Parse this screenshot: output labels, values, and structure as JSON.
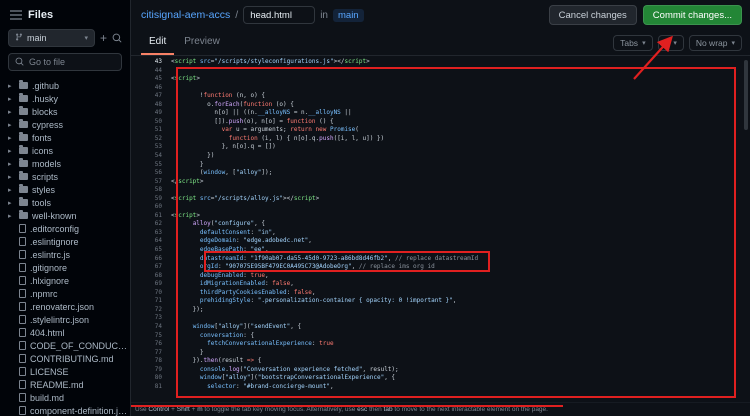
{
  "header": {
    "repo": "citisignal-aem-accs",
    "separator": "/",
    "filename_input": "head.html",
    "in_label": "in",
    "branch": "main",
    "cancel_button": "Cancel changes",
    "commit_button": "Commit changes..."
  },
  "sidebar": {
    "title": "Files",
    "branch": "main",
    "goto_placeholder": "Go to file",
    "folders": [
      ".github",
      ".husky",
      "blocks",
      "cypress",
      "fonts",
      "icons",
      "models",
      "scripts",
      "styles",
      "tools",
      "well-known"
    ],
    "files": [
      ".editorconfig",
      ".eslintignore",
      ".eslintrc.js",
      ".gitignore",
      ".hlxignore",
      ".npmrc",
      ".renovaterc.json",
      ".stylelintrc.json",
      "404.html",
      "CODE_OF_CONDUCT.md",
      "CONTRIBUTING.md",
      "LICENSE",
      "README.md",
      "build.md",
      "component-definition.json"
    ]
  },
  "tabs": {
    "edit": "Edit",
    "preview": "Preview"
  },
  "editor_controls": {
    "indent_mode": "Tabs",
    "indent_size": "4",
    "wrap": "No wrap"
  },
  "colors": {
    "commit_green": "#238636",
    "tab_accent": "#f78166",
    "link_blue": "#58a6ff",
    "annotation_red": "#e02020"
  },
  "status_bar": {
    "segments": [
      {
        "t": "Use "
      },
      {
        "t": "Control",
        "kbd": true
      },
      {
        "t": " + "
      },
      {
        "t": "Shift",
        "kbd": true
      },
      {
        "t": " + "
      },
      {
        "t": "m",
        "kbd": true
      },
      {
        "t": " to toggle the tab key moving focus. Alternatively, use "
      },
      {
        "t": "esc",
        "kbd": true
      },
      {
        "t": " then "
      },
      {
        "t": "tab",
        "kbd": true
      },
      {
        "t": " to move to the next interactable element on the page."
      }
    ]
  },
  "code": {
    "lines": [
      {
        "n": 43,
        "active": true,
        "segs": [
          [
            "p",
            "<"
          ],
          [
            "t",
            "script"
          ],
          [
            "a",
            " src"
          ],
          [
            "p",
            "="
          ],
          [
            "s",
            "\"/scripts/styleconfigurations.js\""
          ],
          [
            "p",
            "></"
          ],
          [
            "t",
            "script"
          ],
          [
            "p",
            ">"
          ]
        ]
      },
      {
        "n": 44,
        "segs": []
      },
      {
        "n": 45,
        "segs": [
          [
            "p",
            "<"
          ],
          [
            "t",
            "script"
          ],
          [
            "p",
            ">"
          ]
        ]
      },
      {
        "n": 46,
        "segs": []
      },
      {
        "n": 47,
        "segs": [
          [
            "p",
            "        !"
          ],
          [
            "k",
            "function"
          ],
          [
            "p",
            " (n, o) {"
          ]
        ]
      },
      {
        "n": 48,
        "segs": [
          [
            "p",
            "          o."
          ],
          [
            "f",
            "forEach"
          ],
          [
            "p",
            "("
          ],
          [
            "k",
            "function"
          ],
          [
            "p",
            " (o) {"
          ]
        ]
      },
      {
        "n": 49,
        "segs": [
          [
            "p",
            "            n[o] || ((n."
          ],
          [
            "b",
            "__alloyNS"
          ],
          [
            "p",
            " = n."
          ],
          [
            "b",
            "__alloyNS"
          ],
          [
            "p",
            " ||"
          ]
        ]
      },
      {
        "n": 50,
        "segs": [
          [
            "p",
            "            [])."
          ],
          [
            "f",
            "push"
          ],
          [
            "p",
            "(o), n[o] = "
          ],
          [
            "k",
            "function"
          ],
          [
            "p",
            " () {"
          ]
        ]
      },
      {
        "n": 51,
        "segs": [
          [
            "p",
            "              "
          ],
          [
            "k",
            "var"
          ],
          [
            "p",
            " u = arguments; "
          ],
          [
            "k",
            "return"
          ],
          [
            "p",
            " "
          ],
          [
            "k",
            "new"
          ],
          [
            "p",
            " "
          ],
          [
            "b",
            "Promise"
          ],
          [
            "p",
            "("
          ]
        ]
      },
      {
        "n": 52,
        "segs": [
          [
            "p",
            "                "
          ],
          [
            "k",
            "function"
          ],
          [
            "p",
            " (i, l) { n[o].q."
          ],
          [
            "f",
            "push"
          ],
          [
            "p",
            "([i, l, u]) })"
          ]
        ]
      },
      {
        "n": 53,
        "segs": [
          [
            "p",
            "              }, n[o].q = [])"
          ]
        ]
      },
      {
        "n": 54,
        "segs": [
          [
            "p",
            "          })"
          ]
        ]
      },
      {
        "n": 55,
        "segs": [
          [
            "p",
            "        }"
          ]
        ]
      },
      {
        "n": 56,
        "segs": [
          [
            "p",
            "        ("
          ],
          [
            "b",
            "window"
          ],
          [
            "p",
            ", ["
          ],
          [
            "s",
            "\"alloy\""
          ],
          [
            "p",
            "]);"
          ]
        ]
      },
      {
        "n": 57,
        "segs": [
          [
            "p",
            "</"
          ],
          [
            "t",
            "script"
          ],
          [
            "p",
            ">"
          ]
        ]
      },
      {
        "n": 58,
        "segs": []
      },
      {
        "n": 59,
        "segs": [
          [
            "p",
            "<"
          ],
          [
            "t",
            "script"
          ],
          [
            "a",
            " src"
          ],
          [
            "p",
            "="
          ],
          [
            "s",
            "\"/scripts/alloy.js\""
          ],
          [
            "p",
            "></"
          ],
          [
            "t",
            "script"
          ],
          [
            "p",
            ">"
          ]
        ]
      },
      {
        "n": 60,
        "segs": []
      },
      {
        "n": 61,
        "segs": [
          [
            "p",
            "<"
          ],
          [
            "t",
            "script"
          ],
          [
            "p",
            ">"
          ]
        ]
      },
      {
        "n": 62,
        "segs": [
          [
            "p",
            "      "
          ],
          [
            "f",
            "alloy"
          ],
          [
            "p",
            "("
          ],
          [
            "s",
            "\"configure\""
          ],
          [
            "p",
            ", {"
          ]
        ]
      },
      {
        "n": 63,
        "segs": [
          [
            "p",
            "        "
          ],
          [
            "b",
            "defaultConsent"
          ],
          [
            "p",
            ": "
          ],
          [
            "s",
            "\"in\""
          ],
          [
            "p",
            ","
          ]
        ]
      },
      {
        "n": 64,
        "segs": [
          [
            "p",
            "        "
          ],
          [
            "b",
            "edgeDomain"
          ],
          [
            "p",
            ": "
          ],
          [
            "s",
            "\"edge.adobedc.net\""
          ],
          [
            "p",
            ","
          ]
        ]
      },
      {
        "n": 65,
        "segs": [
          [
            "p",
            "        "
          ],
          [
            "b",
            "edgeBasePath"
          ],
          [
            "p",
            ": "
          ],
          [
            "s",
            "\"ee\""
          ],
          [
            "p",
            ","
          ]
        ]
      },
      {
        "n": 66,
        "segs": [
          [
            "p",
            "        "
          ],
          [
            "b",
            "datastreamId"
          ],
          [
            "p",
            ": "
          ],
          [
            "s",
            "\"1f90ab07-da55-45d0-9723-a86bd8d46fb2\""
          ],
          [
            "p",
            ", "
          ],
          [
            "c",
            "// replace datastreamId"
          ]
        ]
      },
      {
        "n": 67,
        "segs": [
          [
            "p",
            "        "
          ],
          [
            "b",
            "orgId"
          ],
          [
            "p",
            ": "
          ],
          [
            "s",
            "\"907075E95BF479EC0A495C73@AdobeOrg\""
          ],
          [
            "p",
            ", "
          ],
          [
            "c",
            "// replace ims org id"
          ]
        ]
      },
      {
        "n": 68,
        "segs": [
          [
            "p",
            "        "
          ],
          [
            "b",
            "debugEnabled"
          ],
          [
            "p",
            ": "
          ],
          [
            "k",
            "true"
          ],
          [
            "p",
            ","
          ]
        ]
      },
      {
        "n": 69,
        "segs": [
          [
            "p",
            "        "
          ],
          [
            "b",
            "idMigrationEnabled"
          ],
          [
            "p",
            ": "
          ],
          [
            "k",
            "false"
          ],
          [
            "p",
            ","
          ]
        ]
      },
      {
        "n": 70,
        "segs": [
          [
            "p",
            "        "
          ],
          [
            "b",
            "thirdPartyCookiesEnabled"
          ],
          [
            "p",
            ": "
          ],
          [
            "k",
            "false"
          ],
          [
            "p",
            ","
          ]
        ]
      },
      {
        "n": 71,
        "segs": [
          [
            "p",
            "        "
          ],
          [
            "b",
            "prehidingStyle"
          ],
          [
            "p",
            ": "
          ],
          [
            "s",
            "\".personalization-container { opacity: 0 !important }\""
          ],
          [
            "p",
            ","
          ]
        ]
      },
      {
        "n": 72,
        "segs": [
          [
            "p",
            "      });"
          ]
        ]
      },
      {
        "n": 73,
        "segs": []
      },
      {
        "n": 74,
        "segs": [
          [
            "p",
            "      "
          ],
          [
            "b",
            "window"
          ],
          [
            "p",
            "["
          ],
          [
            "s",
            "\"alloy\""
          ],
          [
            "p",
            "]("
          ],
          [
            "s",
            "\"sendEvent\""
          ],
          [
            "p",
            ", {"
          ]
        ]
      },
      {
        "n": 75,
        "segs": [
          [
            "p",
            "        "
          ],
          [
            "b",
            "conversation"
          ],
          [
            "p",
            ": {"
          ]
        ]
      },
      {
        "n": 76,
        "segs": [
          [
            "p",
            "          "
          ],
          [
            "b",
            "fetchConversationalExperience"
          ],
          [
            "p",
            ": "
          ],
          [
            "k",
            "true"
          ]
        ]
      },
      {
        "n": 77,
        "segs": [
          [
            "p",
            "        }"
          ]
        ]
      },
      {
        "n": 78,
        "segs": [
          [
            "p",
            "      })."
          ],
          [
            "f",
            "then"
          ],
          [
            "p",
            "(result "
          ],
          [
            "k",
            "=>"
          ],
          [
            "p",
            " {"
          ]
        ]
      },
      {
        "n": 79,
        "segs": [
          [
            "p",
            "        "
          ],
          [
            "b",
            "console"
          ],
          [
            "p",
            "."
          ],
          [
            "f",
            "log"
          ],
          [
            "p",
            "("
          ],
          [
            "s",
            "\"Conversation experience fetched\""
          ],
          [
            "p",
            ", result);"
          ]
        ]
      },
      {
        "n": 80,
        "segs": [
          [
            "p",
            "        "
          ],
          [
            "b",
            "window"
          ],
          [
            "p",
            "["
          ],
          [
            "s",
            "\"alloy\""
          ],
          [
            "p",
            "]("
          ],
          [
            "s",
            "\"bootstrapConversationalExperience\""
          ],
          [
            "p",
            ", {"
          ]
        ]
      },
      {
        "n": 81,
        "segs": [
          [
            "p",
            "          "
          ],
          [
            "b",
            "selector"
          ],
          [
            "p",
            ": "
          ],
          [
            "s",
            "\"#brand-concierge-mount\""
          ],
          [
            "p",
            ","
          ]
        ]
      }
    ]
  }
}
